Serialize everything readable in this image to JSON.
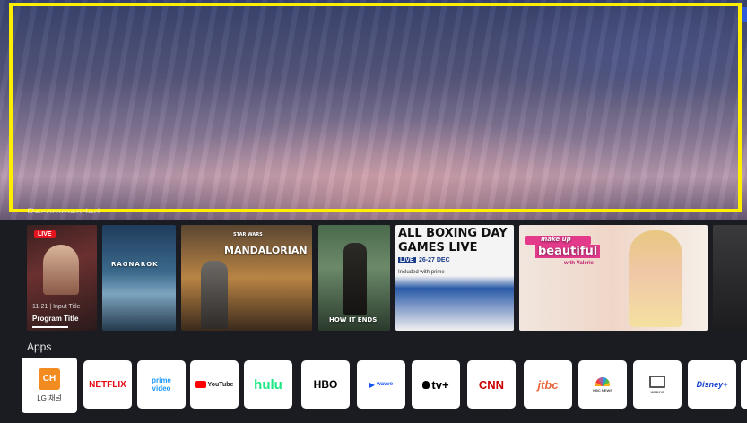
{
  "hero": {
    "section_label": "Recommended"
  },
  "recommended": [
    {
      "badge": "LIVE",
      "time": "11-21 | Input Title",
      "title": "Program Title",
      "kind": "live-channel"
    },
    {
      "poster_text": "RAGNAROK",
      "kind": "poster"
    },
    {
      "poster_top": "STAR WARS",
      "poster_text": "MANDALORIAN",
      "kind": "poster"
    },
    {
      "poster_text": "HOW IT ENDS",
      "kind": "poster"
    },
    {
      "lines": [
        "ALL BOXING DAY",
        "GAMES LIVE"
      ],
      "badge": "LIVE",
      "dates": "26-27 DEC",
      "sub": "Included with prime",
      "kind": "sports-poster"
    },
    {
      "poster_top": "make up",
      "poster_text": "beautiful",
      "sub": "with Valerie",
      "kind": "show-poster"
    }
  ],
  "apps_label": "Apps",
  "apps": [
    {
      "name": "LG 채널",
      "logo": "CH",
      "icon": "lg-channels-icon",
      "color": "#f28b20"
    },
    {
      "name": "NETFLIX",
      "logo": "NETFLIX",
      "icon": "netflix-icon",
      "color": "#e50914"
    },
    {
      "name": "prime video",
      "logo": "prime video",
      "icon": "prime-video-icon",
      "color": "#1a98ff"
    },
    {
      "name": "YouTube",
      "logo": "YouTube",
      "icon": "youtube-icon",
      "color": "#ff0000"
    },
    {
      "name": "hulu",
      "logo": "hulu",
      "icon": "hulu-icon",
      "color": "#1ce783"
    },
    {
      "name": "HBO",
      "logo": "HBO",
      "icon": "hbo-icon",
      "color": "#000000"
    },
    {
      "name": "wavve",
      "logo": "wavve",
      "icon": "wavve-icon",
      "color": "#1351f9"
    },
    {
      "name": "Apple TV+",
      "logo": "tv+",
      "icon": "apple-tv-icon",
      "color": "#000000"
    },
    {
      "name": "CNN",
      "logo": "CNN",
      "icon": "cnn-icon",
      "color": "#cc0000"
    },
    {
      "name": "JTBC",
      "logo": "jtbc",
      "icon": "jtbc-icon",
      "color": "#e8683e"
    },
    {
      "name": "NBC News",
      "logo": "NBC NEWS",
      "icon": "nbc-news-icon",
      "color": "#6e6e6e"
    },
    {
      "name": "Web",
      "logo": "WEBOS",
      "icon": "web-browser-icon",
      "color": "#555555"
    },
    {
      "name": "Disney+",
      "logo": "Disney+",
      "icon": "disney-plus-icon",
      "color": "#113ccf"
    }
  ]
}
